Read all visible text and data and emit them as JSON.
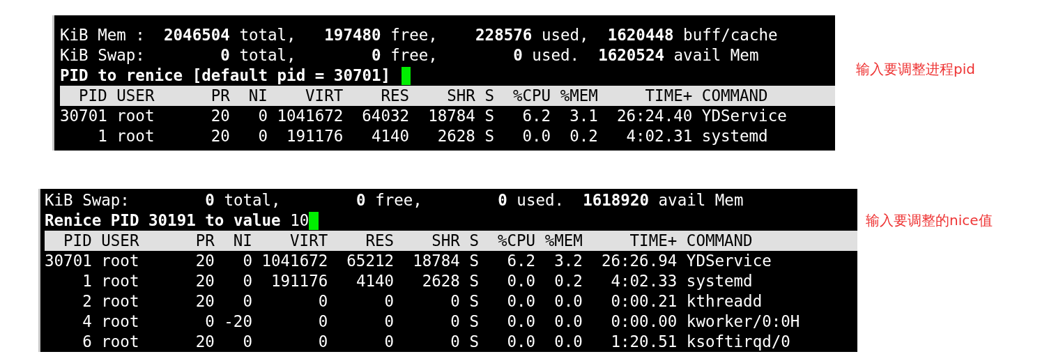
{
  "panels": [
    {
      "lines": [
        "KiB Mem :  **2046504** total,   **197480** free,    **228576** used,  **1620448** buff/cache",
        "KiB Swap:        **0** total,        **0** free,        **0** used.  **1620524** avail Mem"
      ],
      "prompt": {
        "text": "PID to renice [default pid = 30701] "
      },
      "columns": [
        "PID",
        "USER",
        "PR",
        "NI",
        "VIRT",
        "RES",
        "SHR",
        "S",
        "%CPU",
        "%MEM",
        "TIME+",
        "COMMAND"
      ],
      "rows": [
        [
          "30701",
          "root",
          "20",
          "0",
          "1041672",
          "64032",
          "18784",
          "S",
          "6.2",
          "3.1",
          "26:24.40",
          "YDService"
        ],
        [
          "1",
          "root",
          "20",
          "0",
          "191176",
          "4140",
          "2628",
          "S",
          "0.0",
          "0.2",
          "4:02.31",
          "systemd"
        ]
      ],
      "note": "输入要调整进程pid"
    },
    {
      "lines": [
        "KiB Swap:        **0** total,        **0** free,        **0** used.  **1618920** avail Mem"
      ],
      "prompt": {
        "text": "Renice PID 30191 to value ",
        "input": "10"
      },
      "columns": [
        "PID",
        "USER",
        "PR",
        "NI",
        "VIRT",
        "RES",
        "SHR",
        "S",
        "%CPU",
        "%MEM",
        "TIME+",
        "COMMAND"
      ],
      "rows": [
        [
          "30701",
          "root",
          "20",
          "0",
          "1041672",
          "65212",
          "18784",
          "S",
          "6.2",
          "3.2",
          "26:26.94",
          "YDService"
        ],
        [
          "1",
          "root",
          "20",
          "0",
          "191176",
          "4140",
          "2628",
          "S",
          "0.0",
          "0.2",
          "4:02.33",
          "systemd"
        ],
        [
          "2",
          "root",
          "20",
          "0",
          "0",
          "0",
          "0",
          "S",
          "0.0",
          "0.0",
          "0:00.21",
          "kthreadd"
        ],
        [
          "4",
          "root",
          "0",
          "-20",
          "0",
          "0",
          "0",
          "S",
          "0.0",
          "0.0",
          "0:00.00",
          "kworker/0:0H"
        ],
        [
          "6",
          "root",
          "20",
          "0",
          "0",
          "0",
          "0",
          "S",
          "0.0",
          "0.0",
          "1:20.51",
          "ksoftirqd/0"
        ]
      ],
      "note": "输入要调整的nice值"
    }
  ]
}
